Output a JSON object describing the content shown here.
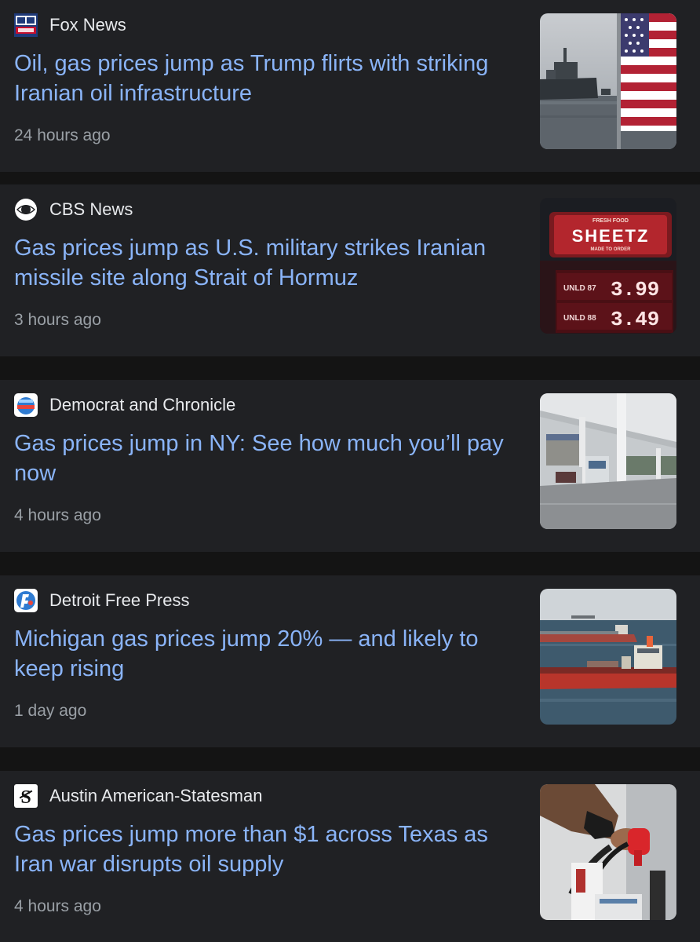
{
  "articles": [
    {
      "source": "Fox News",
      "logo_icon": "fox-news-logo-icon",
      "headline": "Oil, gas prices jump as Trump flirts with striking Iranian oil infrastructure",
      "time": "24 hours ago",
      "thumbnail": "tanker-and-us-flag-image"
    },
    {
      "source": "CBS News",
      "logo_icon": "cbs-eye-logo-icon",
      "headline": "Gas prices jump as U.S. military strikes Iranian missile site along Strait of Hormuz",
      "time": "3 hours ago",
      "thumbnail": "sheetz-price-sign-image",
      "thumbnail_text": {
        "brand": "SHEETZ",
        "tagline_top": "FRESH FOOD",
        "tagline_bottom": "MADE TO ORDER",
        "row1_label": "UNLD 87",
        "row1_price": "3.99",
        "row2_label": "UNLD 88",
        "row2_price": "3.49"
      }
    },
    {
      "source": "Democrat and Chronicle",
      "logo_icon": "democrat-chronicle-logo-icon",
      "headline": "Gas prices jump in NY: See how much you’ll pay now",
      "time": "4 hours ago",
      "thumbnail": "gas-station-canopy-image"
    },
    {
      "source": "Detroit Free Press",
      "logo_icon": "detroit-free-press-logo-icon",
      "headline": "Michigan gas prices jump 20% — and likely to keep rising",
      "time": "1 day ago",
      "thumbnail": "oil-tankers-at-sea-image"
    },
    {
      "source": "Austin American-Statesman",
      "logo_icon": "statesman-logo-icon",
      "headline": "Gas prices jump more than $1 across Texas as Iran war disrupts oil supply",
      "time": "4 hours ago",
      "thumbnail": "fuel-pump-nozzle-image"
    }
  ],
  "colors": {
    "page_background": "#141414",
    "card_background": "#202124",
    "source_text": "#e8eaed",
    "headline_link": "#8ab4f8",
    "timestamp": "#9aa0a6"
  }
}
